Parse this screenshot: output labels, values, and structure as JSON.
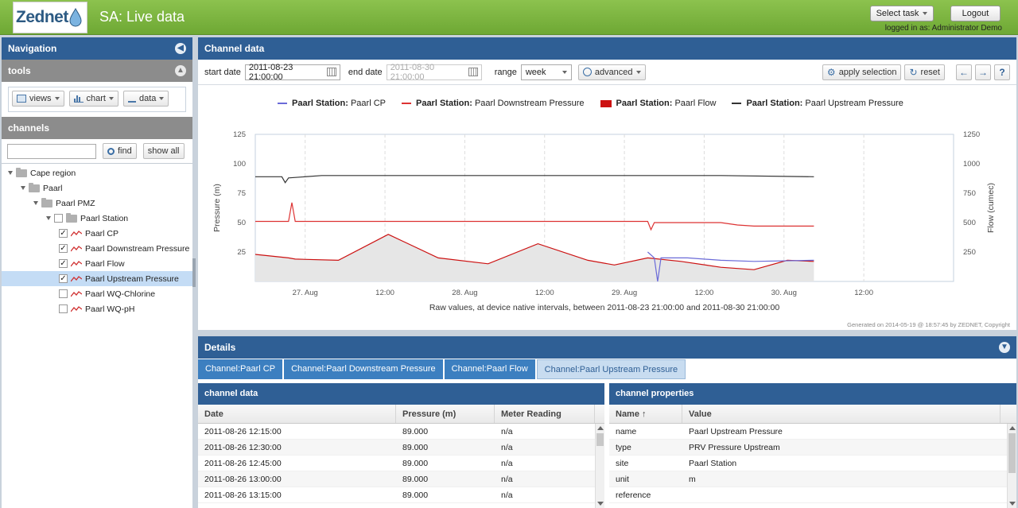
{
  "header": {
    "logo_text": "Zednet",
    "title": "SA: Live data",
    "select_task_label": "Select task",
    "logout_label": "Logout",
    "login_info": "logged in as: Administrator Demo"
  },
  "navigation": {
    "title": "Navigation",
    "tools_title": "tools",
    "tools": {
      "views_label": "views",
      "chart_label": "chart",
      "data_label": "data"
    },
    "channels_title": "channels",
    "search_value": "",
    "find_label": "find",
    "show_all_label": "show all",
    "tree": [
      {
        "label": "Cape region",
        "level": 0,
        "type": "folder",
        "expanded": true
      },
      {
        "label": "Paarl",
        "level": 1,
        "type": "folder",
        "expanded": true
      },
      {
        "label": "Paarl PMZ",
        "level": 2,
        "type": "folder",
        "expanded": true
      },
      {
        "label": "Paarl Station",
        "level": 3,
        "type": "folder",
        "expanded": true,
        "checkbox": true,
        "checked": false
      },
      {
        "label": "Paarl CP",
        "level": 4,
        "type": "channel",
        "checked": true
      },
      {
        "label": "Paarl Downstream Pressure",
        "level": 4,
        "type": "channel",
        "checked": true
      },
      {
        "label": "Paarl Flow",
        "level": 4,
        "type": "channel",
        "checked": true
      },
      {
        "label": "Paarl Upstream Pressure",
        "level": 4,
        "type": "channel",
        "checked": true,
        "selected": true
      },
      {
        "label": "Paarl WQ-Chlorine",
        "level": 4,
        "type": "channel",
        "checked": false
      },
      {
        "label": "Paarl WQ-pH",
        "level": 4,
        "type": "channel",
        "checked": false
      }
    ]
  },
  "channel_data": {
    "title": "Channel data",
    "start_date_label": "start date",
    "start_date_value": "2011-08-23 21:00:00",
    "end_date_label": "end date",
    "end_date_value": "2011-08-30 21:00:00",
    "range_label": "range",
    "range_value": "week",
    "advanced_label": "advanced",
    "apply_label": "apply selection",
    "reset_label": "reset",
    "generated_note": "Generated on 2014-05-19 @ 18:57:45 by ZEDNET, Copyright"
  },
  "chart_data": {
    "type": "line",
    "legend_position": "top",
    "legend": [
      {
        "prefix": "Paarl Station:",
        "name": "Paarl CP",
        "color": "#6a6ad8",
        "marker": "line"
      },
      {
        "prefix": "Paarl Station:",
        "name": "Paarl Downstream Pressure",
        "color": "#dd3333",
        "marker": "line"
      },
      {
        "prefix": "Paarl Station:",
        "name": "Paarl Flow",
        "color": "#cc1111",
        "marker": "box"
      },
      {
        "prefix": "Paarl Station:",
        "name": "Paarl Upstream Pressure",
        "color": "#333333",
        "marker": "line"
      }
    ],
    "ylabel": "Pressure (m)",
    "y2label": "Flow (cumec)",
    "ylim": [
      0,
      125
    ],
    "y2lim": [
      0,
      1250
    ],
    "yticks": [
      "25",
      "50",
      "75",
      "100",
      "125"
    ],
    "y2ticks": [
      "250",
      "500",
      "750",
      "1000",
      "1250"
    ],
    "xlim_hours": [
      0,
      168
    ],
    "xticks": [
      {
        "label": "27. Aug",
        "h": 15
      },
      {
        "label": "12:00",
        "h": 39
      },
      {
        "label": "28. Aug",
        "h": 63
      },
      {
        "label": "12:00",
        "h": 87
      },
      {
        "label": "29. Aug",
        "h": 111
      },
      {
        "label": "12:00",
        "h": 135
      },
      {
        "label": "30. Aug",
        "h": 159
      },
      {
        "label": "12:00",
        "h": 183
      }
    ],
    "caption": "Raw values, at device native intervals, between 2011-08-23 21:00:00 and 2011-08-30 21:00:00",
    "series": [
      {
        "name": "Paarl Upstream Pressure",
        "color": "#333333",
        "axis": "left",
        "points": [
          [
            0,
            89
          ],
          [
            8,
            89
          ],
          [
            9,
            84
          ],
          [
            10,
            88
          ],
          [
            20,
            90
          ],
          [
            60,
            90
          ],
          [
            100,
            90
          ],
          [
            140,
            90
          ],
          [
            168,
            89
          ]
        ]
      },
      {
        "name": "Paarl Downstream Pressure",
        "color": "#dd3333",
        "axis": "left",
        "points": [
          [
            0,
            51
          ],
          [
            10,
            51
          ],
          [
            11,
            67
          ],
          [
            12,
            51
          ],
          [
            60,
            51
          ],
          [
            100,
            51
          ],
          [
            118,
            51
          ],
          [
            119,
            44
          ],
          [
            120,
            50
          ],
          [
            140,
            50
          ],
          [
            145,
            48
          ],
          [
            150,
            47
          ],
          [
            168,
            47
          ]
        ]
      },
      {
        "name": "Paarl Flow",
        "color": "#cc1111",
        "axis": "right",
        "points": [
          [
            0,
            230
          ],
          [
            10,
            200
          ],
          [
            12,
            190
          ],
          [
            25,
            180
          ],
          [
            40,
            400
          ],
          [
            55,
            200
          ],
          [
            70,
            150
          ],
          [
            85,
            320
          ],
          [
            100,
            180
          ],
          [
            108,
            140
          ],
          [
            118,
            200
          ],
          [
            128,
            170
          ],
          [
            140,
            120
          ],
          [
            150,
            100
          ],
          [
            160,
            180
          ],
          [
            168,
            170
          ]
        ]
      },
      {
        "name": "Paarl CP",
        "color": "#6a6ad8",
        "axis": "left",
        "points": [
          [
            118,
            25
          ],
          [
            120,
            20
          ],
          [
            121,
            0
          ],
          [
            122,
            20
          ],
          [
            130,
            20
          ],
          [
            140,
            18
          ],
          [
            150,
            17
          ],
          [
            168,
            18
          ]
        ]
      }
    ]
  },
  "details": {
    "title": "Details",
    "tabs": [
      "Channel:Paarl CP",
      "Channel:Paarl Downstream Pressure",
      "Channel:Paarl Flow",
      "Channel:Paarl Upstream Pressure"
    ],
    "active_tab": 3,
    "channel_data_panel": {
      "title": "channel data",
      "columns": [
        "Date",
        "Pressure (m)",
        "Meter Reading"
      ],
      "rows": [
        [
          "2011-08-26 12:15:00",
          "89.000",
          "n/a"
        ],
        [
          "2011-08-26 12:30:00",
          "89.000",
          "n/a"
        ],
        [
          "2011-08-26 12:45:00",
          "89.000",
          "n/a"
        ],
        [
          "2011-08-26 13:00:00",
          "89.000",
          "n/a"
        ],
        [
          "2011-08-26 13:15:00",
          "89.000",
          "n/a"
        ]
      ]
    },
    "properties_panel": {
      "title": "channel properties",
      "columns": [
        "Name ↑",
        "Value"
      ],
      "rows": [
        [
          "name",
          "Paarl Upstream Pressure"
        ],
        [
          "type",
          "PRV Pressure Upstream"
        ],
        [
          "site",
          "Paarl Station"
        ],
        [
          "unit",
          "m"
        ],
        [
          "reference",
          ""
        ]
      ]
    }
  }
}
